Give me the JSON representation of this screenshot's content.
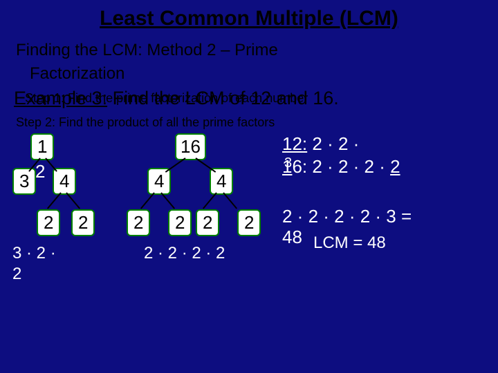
{
  "title": "Least Common Multiple (LCM)",
  "subtitle_l1": "Finding the LCM: Method 2 – Prime",
  "subtitle_l2": "Factorization",
  "example_label": "Example 3:",
  "example_text": " Find the LCM of 12 and 16.",
  "step1": "Step 1: Find the prime factorization of each number",
  "step2": "Step 2: Find the product of all the prime factors",
  "tree12": {
    "root": "1",
    "rootExtra": "2",
    "left": "3",
    "right": "4",
    "rl": "2",
    "rr": "2",
    "expr": "3 · 2 ·",
    "expr2": "2"
  },
  "tree16": {
    "root": "16",
    "left": "4",
    "right": "4",
    "ll": "2",
    "lr": "2",
    "rl": "2",
    "rr": "2",
    "expr": "2 · 2 · 2 · 2"
  },
  "results": {
    "line1_num": "12:",
    "line1_rest": " 2 · 2 ·",
    "line2_num1": "1",
    "line2_mid": "6: 2 · 2 · 2 · ",
    "line2_last": "2",
    "line2_small3": "3",
    "calc": "2 · 2 · 2 · 2 · 3 =",
    "ans48": "48",
    "lcm": "LCM = 48"
  }
}
